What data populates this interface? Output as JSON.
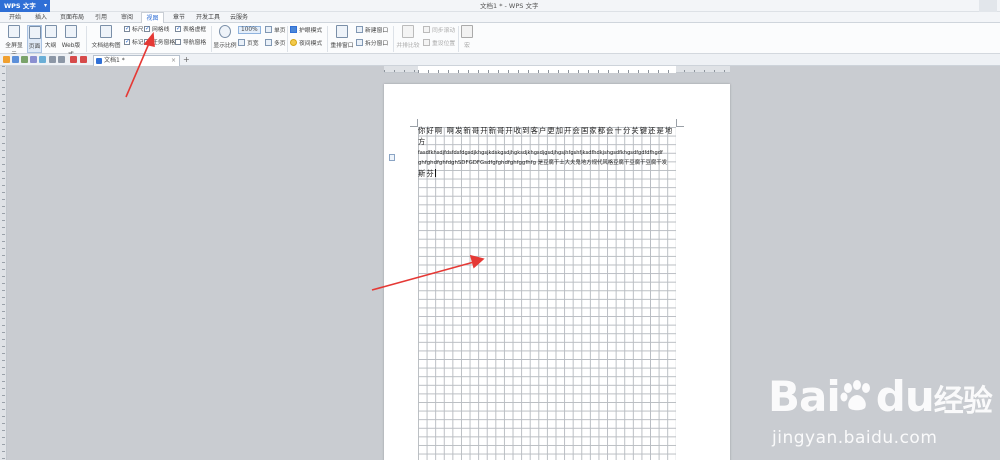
{
  "app": {
    "name": "WPS 文字",
    "window_title": "文档1 * - WPS 文字"
  },
  "menu_tabs": [
    "开始",
    "插入",
    "页面布局",
    "引用",
    "审阅",
    "视图",
    "章节",
    "开发工具",
    "云服务"
  ],
  "active_tab": "视图",
  "ribbon": {
    "full_screen": "全屏显示",
    "page_view": "页面",
    "outline": "大纲",
    "web_layout": "Web版式",
    "doc_structure": "文档结构图",
    "ruler": "标尺",
    "gridlines": "网格线",
    "table_gridlines": "表格虚框",
    "markup": "标记",
    "task_pane": "任务窗格",
    "nav_pane": "导航窗格",
    "show_ratio": "显示比例",
    "zoom_value": "100%",
    "single_page": "单页",
    "page_width": "页宽",
    "multi_page": "多页",
    "eye_protect": "护眼模式",
    "night_mode": "夜间模式",
    "rearrange_window": "重排窗口",
    "new_window": "新建窗口",
    "split_window": "拆分窗口",
    "side_by_side": "并排比较",
    "sync_scroll": "同步滚动",
    "reset_position": "重设位置",
    "macro": "宏"
  },
  "checkboxes": {
    "ruler": true,
    "gridlines": true,
    "table_gridlines": true,
    "markup": true
  },
  "doc_tab": {
    "title": "文档1 *",
    "close": "×",
    "add": "+"
  },
  "document": {
    "line1": "你好啊 啊发新哥开新哥开收到客户更加开会国家都会十分关键还是地方",
    "line2": "fasdfkhsdjfdsfdsfdgsdjkhgsjkdskgsdjhgksdjkhgsdjgsdjhgsjhfgshfjksdfhdkjshgsdfkhgsdfgdfdfhgdf",
    "line3": "ghfghdfghfdghSDFGDFGsdfgfghdfghfggfhfg 是豆腐干士大夫鬼地方规代风格豆腐干豆腐干豆腐干发",
    "line4": "斯芬"
  },
  "watermark": {
    "brand": "Bai",
    "brand_tail": "du",
    "cn": "经验",
    "url": "jingyan.baidu.com"
  },
  "colors": {
    "accent": "#2f6fd6",
    "arrow": "#e53935",
    "workspace": "#c9ccd1"
  }
}
